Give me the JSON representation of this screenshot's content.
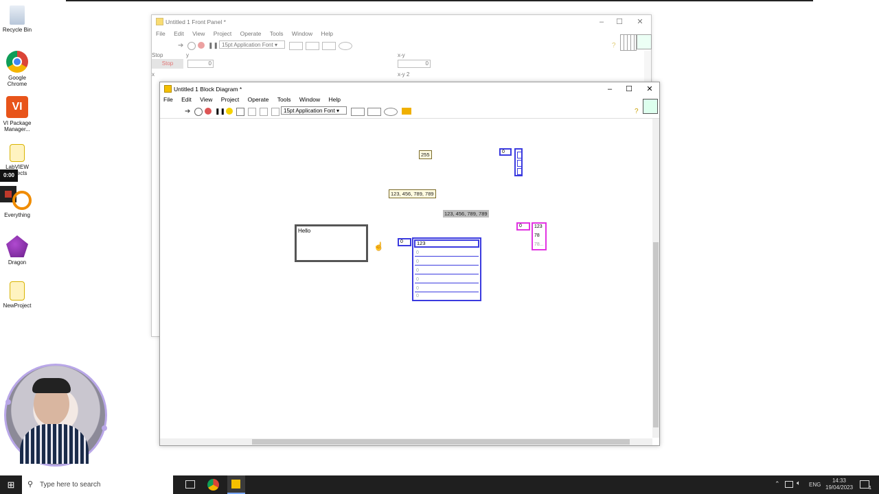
{
  "desktop": {
    "icons": [
      {
        "label": "Recycle Bin",
        "icon": "recycle-bin-icon"
      },
      {
        "label": "Google Chrome",
        "icon": "chrome-icon"
      },
      {
        "label": "VI Package Manager...",
        "icon": "vipm-icon"
      },
      {
        "label": "LabVIEW Projects",
        "icon": "labview-file-icon"
      },
      {
        "label": "Everything",
        "icon": "everything-search-icon"
      },
      {
        "label": "Dragon",
        "icon": "dragon-icon"
      },
      {
        "label": "NewProject",
        "icon": "folder-icon"
      }
    ],
    "recording_timer": "0:00"
  },
  "front_panel": {
    "title": "Untitled 1 Front Panel *",
    "menu": [
      "File",
      "Edit",
      "View",
      "Project",
      "Operate",
      "Tools",
      "Window",
      "Help"
    ],
    "font_select": "15pt Application Font",
    "controls": {
      "stop_label": "Stop",
      "stop_button": "Stop",
      "y_label": "y",
      "y_value": "0",
      "xy_label": "x-y",
      "xy_value": "0",
      "x_label": "x",
      "xy2_label": "x-y 2"
    }
  },
  "block_diagram": {
    "title": "Untitled 1 Block Diagram *",
    "menu": [
      "File",
      "Edit",
      "View",
      "Project",
      "Operate",
      "Tools",
      "Window",
      "Help"
    ],
    "font_select": "15pt Application Font",
    "constants": {
      "num_255": "255",
      "string_a": "123, 456, 789, 789",
      "string_b": "123, 456, 789, 789",
      "string_hello": "Hello",
      "array_index_blue_small": "0",
      "array_index_pink": "0",
      "pink_values": [
        "123",
        "78",
        "78..."
      ],
      "array_index_blue_large": "0",
      "blue_large_first": "123",
      "blue_large_rest": [
        "0",
        "0",
        "0",
        "0",
        "0",
        "0"
      ]
    }
  },
  "taskbar": {
    "search_placeholder": "Type here to search",
    "tray_lang": "ENG",
    "time": "14:33",
    "date": "19/04/2023",
    "notification_count": "1"
  },
  "colors": {
    "array_blue": "#3a3adf",
    "array_pink": "#e233e2",
    "labview_yellow": "#f5c000",
    "taskbar": "#1f1f1f"
  }
}
